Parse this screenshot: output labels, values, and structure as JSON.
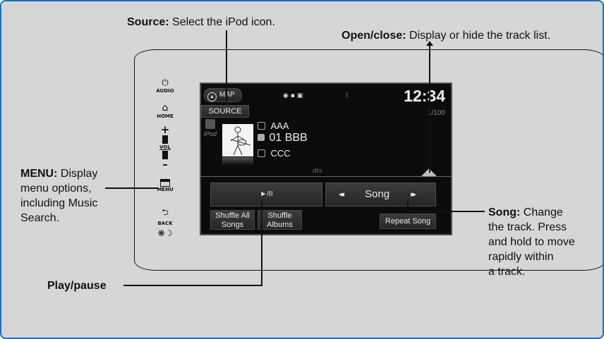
{
  "callouts": {
    "source": {
      "title": "Source:",
      "text": " Select the iPod icon."
    },
    "open_close": {
      "title": "Open/close:",
      "text": " Display or hide the track list."
    },
    "menu": {
      "title": "MENU:",
      "line1": " Display",
      "line2": "menu options,",
      "line3": "including Music",
      "line4": "Search."
    },
    "song": {
      "title": "Song:",
      "line1": " Change",
      "line2": "the track. Press",
      "line3": "and hold to move",
      "line4": "rapidly within",
      "line5": "a track."
    },
    "play_pause": {
      "title": "Play/pause"
    }
  },
  "hardkeys": {
    "audio": "AUDIO",
    "home": "HOME",
    "vol": "VOL",
    "menu": "MENU",
    "back": "BACK"
  },
  "screen": {
    "map_label": "MAP",
    "clock": "12:34",
    "source_label": "SOURCE",
    "track_count": "1/100",
    "source_icon_label": "iPod",
    "artist": "AAA",
    "song": "01 BBB",
    "album": "CCC",
    "dts": "dts",
    "play_pause_glyph": "►/II",
    "song_label": "Song",
    "prev_glyph": "◂◂",
    "next_glyph": "▸▸",
    "shuffle_all": [
      "Shuffle All",
      "Songs"
    ],
    "shuffle_albums": [
      "Shuffle",
      "Albums"
    ],
    "repeat_song": "Repeat Song"
  }
}
